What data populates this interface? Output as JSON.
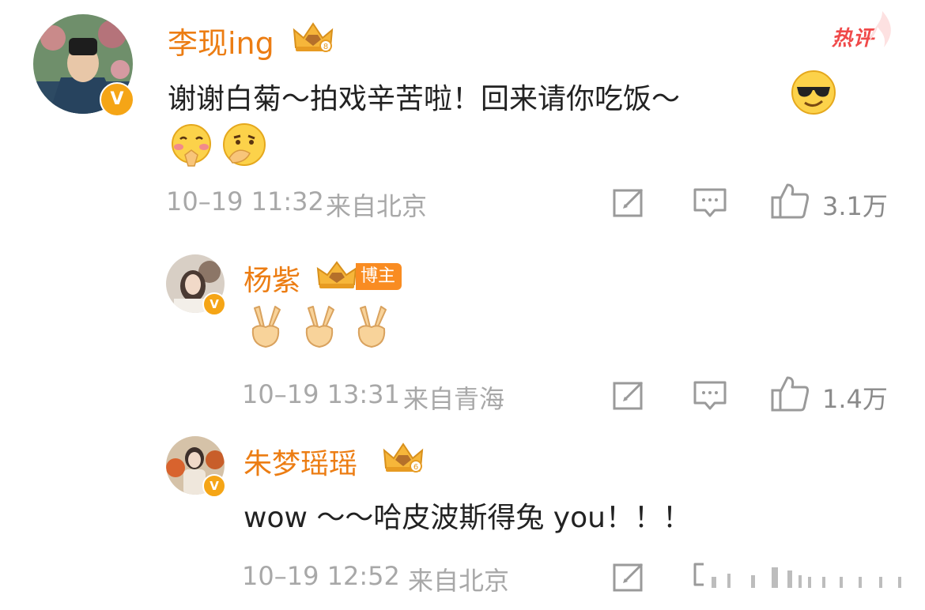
{
  "comments": [
    {
      "username": "李现ing",
      "text": "谢谢白菊～拍戏辛苦啦！回来请你吃饭～",
      "time": "10–19 11:32",
      "location": "来自北京",
      "likes": "3.1万",
      "hot_label": "热评",
      "badge": "V",
      "emojis": [
        "sunglasses-emoji",
        "blush-pray-emoji",
        "thinking-emoji"
      ]
    },
    {
      "username": "杨紫",
      "tag": "博主",
      "text": "",
      "time": "10–19 13:31",
      "location": "来自青海",
      "likes": "1.4万",
      "badge": "V",
      "emojis": [
        "victory-hand-emoji",
        "victory-hand-emoji",
        "victory-hand-emoji"
      ]
    },
    {
      "username": "朱梦瑶瑶",
      "text": "wow ～～哈皮波斯得兔 you！！！",
      "time": "10–19 12:52",
      "location": "来自北京",
      "badge": "V"
    }
  ],
  "colors": {
    "username": "#ec7d13",
    "meta": "#a8a8a8",
    "verified": "#f5a516",
    "hot": "#f04a4a"
  },
  "icons": [
    "edit-icon",
    "comment-icon",
    "thumbs-up-icon",
    "crown-badge-icon"
  ]
}
